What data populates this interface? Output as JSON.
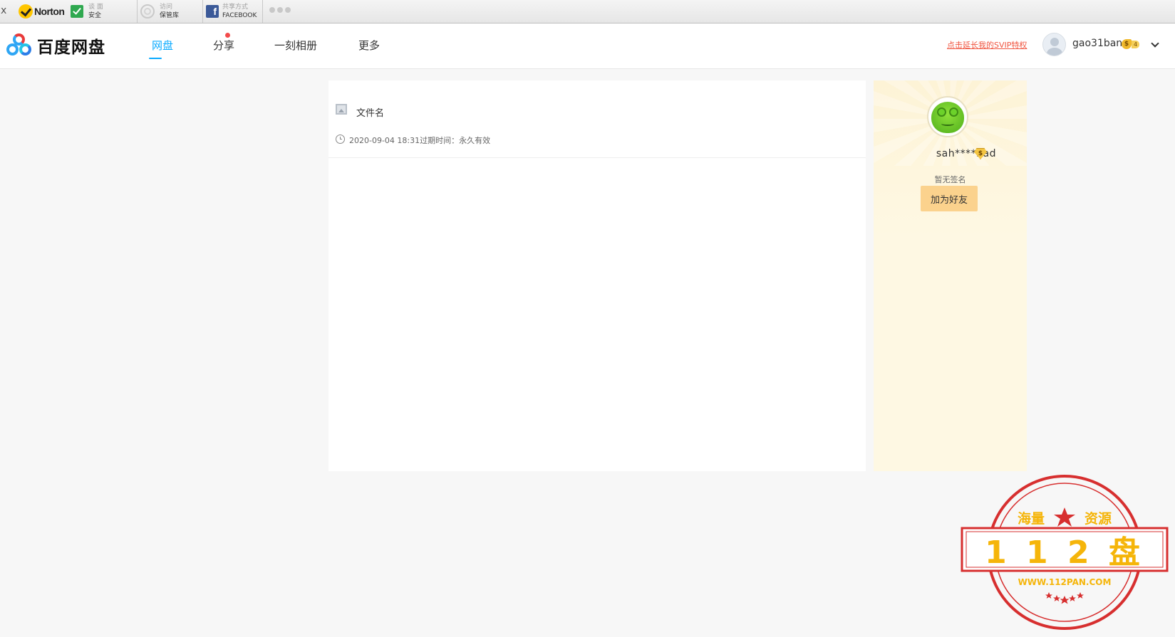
{
  "toolbar": {
    "close": "x",
    "brand": "Norton",
    "safe_top": "谈 面",
    "safe_bottom": "安全",
    "vault_top": "访问",
    "vault_bottom": "保管库",
    "share_top": "共享方式",
    "share_bottom": "FACEBOOK"
  },
  "header": {
    "logo_text": "百度网盘",
    "nav": [
      "网盘",
      "分享",
      "一刻相册",
      "更多"
    ],
    "svip_link": "点击延长我的SVIP特权",
    "username": "gao31ban",
    "vip_symbol": "$",
    "vip_level": "4"
  },
  "file": {
    "name": "文件名",
    "meta": "2020-09-04 18:31过期时间：永久有效"
  },
  "sharer": {
    "name": "sah****bad",
    "badge": "$",
    "signature": "暂无签名",
    "add_friend": "加为好友"
  },
  "watermark": {
    "top_left": "海量",
    "top_right": "资源",
    "main": "1 1 2 盘",
    "url": "WWW.112PAN.COM"
  },
  "colors": {
    "accent": "#09aaff",
    "svip_link": "#f05540",
    "add_friend_bg": "#fbd28d",
    "stamp_red": "#d72f2f",
    "stamp_gold": "#f5b50a"
  }
}
